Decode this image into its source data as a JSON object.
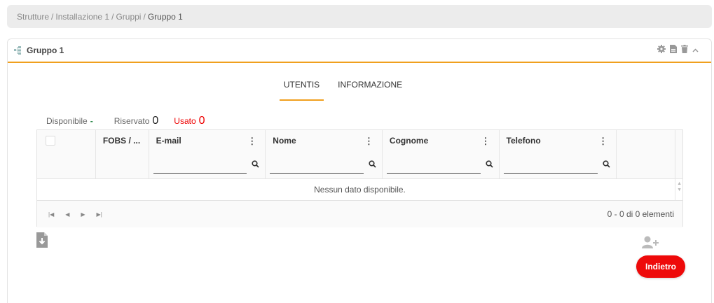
{
  "breadcrumb": {
    "items": [
      "Strutture",
      "Installazione 1",
      "Gruppi"
    ],
    "separator": "/",
    "current": "Gruppo 1"
  },
  "panel": {
    "title": "Gruppo 1",
    "header_icons": [
      "gear-icon",
      "pdf-file-icon",
      "trash-icon",
      "chevron-up-icon"
    ],
    "accent_color": "#f0a01e"
  },
  "tabs": [
    {
      "label": "UTENTIS",
      "active": true
    },
    {
      "label": "INFORMAZIONE",
      "active": false
    }
  ],
  "stats": {
    "available_label": "Disponibile",
    "available_value": "-",
    "reserved_label": "Riservato",
    "reserved_value": "0",
    "used_label": "Usato",
    "used_value": "0"
  },
  "grid": {
    "columns": [
      "FOBS / ...",
      "E-mail",
      "Nome",
      "Cognome",
      "Telefono"
    ],
    "empty_message": "Nessun dato disponibile.",
    "pager_info": "0 - 0 di 0 elementi"
  },
  "actions": {
    "back_label": "Indietro",
    "back_color": "#ee0a0a"
  }
}
